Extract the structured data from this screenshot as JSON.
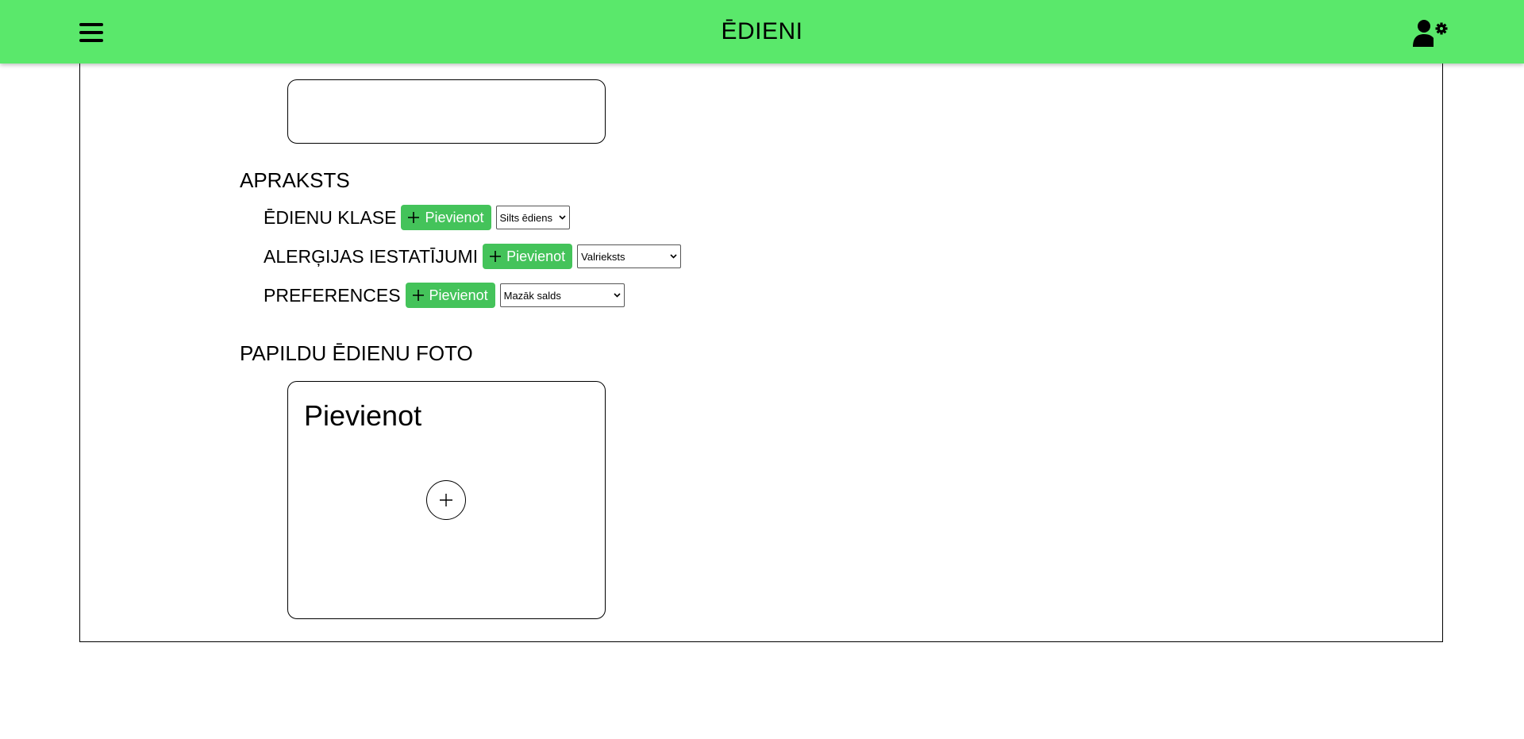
{
  "header": {
    "title": "ĒDIENI",
    "menu_icon": "hamburger-menu-icon",
    "user_icon": "user-settings-icon"
  },
  "colors": {
    "header_bg": "#5ae86b",
    "button_bg": "#44c35a"
  },
  "description": {
    "heading": "APRAKSTS",
    "rows": [
      {
        "label": "ĒDIENU KLASE",
        "button": "Pievienot",
        "selected": "Silts ēdiens"
      },
      {
        "label": "ALERĢIJAS IESTATĪJUMI",
        "button": "Pievienot",
        "selected": "Valrieksts"
      },
      {
        "label": "PREFERENCES",
        "button": "Pievienot",
        "selected": "Mazāk salds"
      }
    ]
  },
  "extra_photos": {
    "heading": "PAPILDU ĒDIENU FOTO",
    "card_title": "Pievienot",
    "add_icon": "plus-circle-icon"
  }
}
